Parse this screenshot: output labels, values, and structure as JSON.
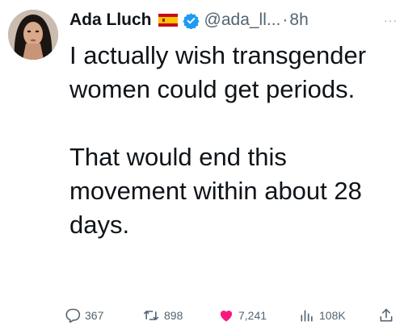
{
  "user": {
    "name": "Ada Lluch",
    "handle": "@ada_ll...",
    "separator": "·",
    "time": "8h",
    "more": "···"
  },
  "tweet": {
    "paragraphs": [
      "I actually wish transgender women could get periods.",
      "That would end this movement within about 28 days."
    ]
  },
  "actions": {
    "replies": "367",
    "retweets": "898",
    "likes": "7,241",
    "views": "108K"
  },
  "colors": {
    "text": "#0f1419",
    "secondary": "#536471",
    "like": "#f91880",
    "verified": "#1d9bf0"
  },
  "icons": {
    "reply": "reply-icon",
    "retweet": "retweet-icon",
    "like": "heart-icon",
    "views": "views-icon",
    "share": "share-icon",
    "verified": "verified-badge-icon",
    "flag": "spain-flag-icon"
  }
}
